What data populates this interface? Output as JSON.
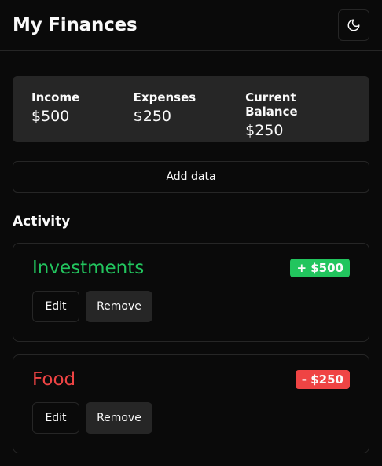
{
  "header": {
    "title": "My Finances",
    "theme_icon": "moon-icon"
  },
  "summary": {
    "income_label": "Income",
    "income_value": "$500",
    "expenses_label": "Expenses",
    "expenses_value": "$250",
    "balance_label": "Current Balance",
    "balance_value": "$250"
  },
  "add_data_label": "Add data",
  "activity": {
    "title": "Activity",
    "items": [
      {
        "name": "Investments",
        "amount": "+ $500",
        "type": "income",
        "edit_label": "Edit",
        "remove_label": "Remove"
      },
      {
        "name": "Food",
        "amount": "- $250",
        "type": "expense",
        "edit_label": "Edit",
        "remove_label": "Remove"
      }
    ]
  },
  "colors": {
    "income": "#22c55e",
    "expense": "#ef4444",
    "background": "#0a0a0a",
    "surface": "#262626"
  }
}
